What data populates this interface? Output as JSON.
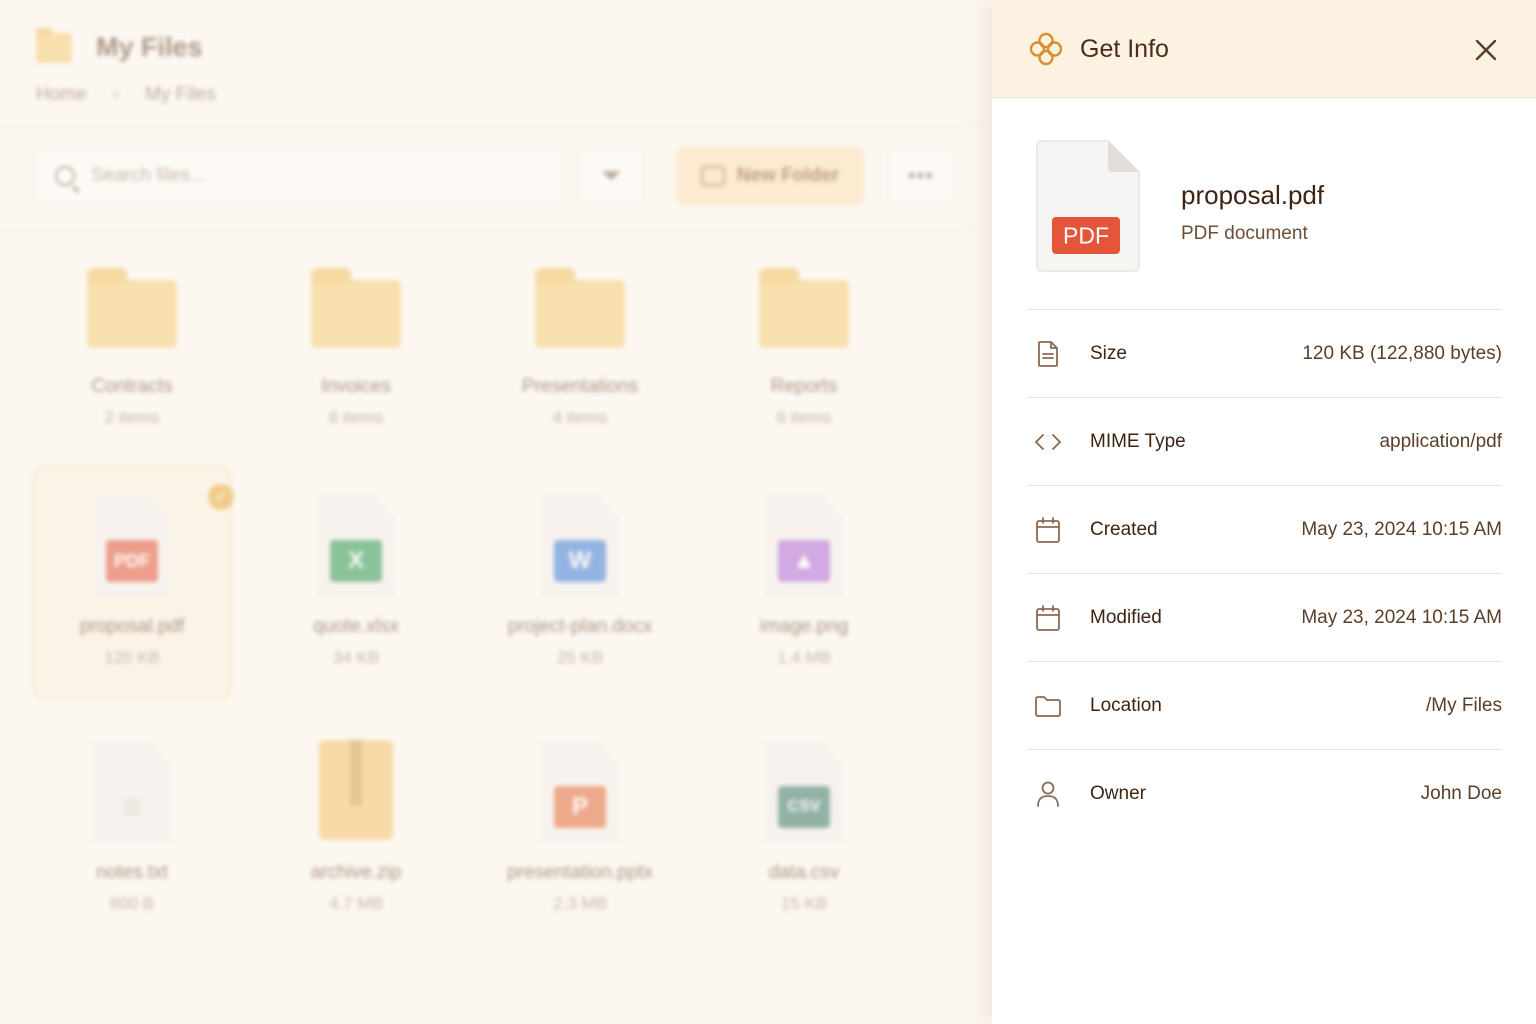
{
  "background": {
    "title": "My Files",
    "breadcrumb": [
      "Home",
      "My Files"
    ],
    "search_placeholder": "Search files...",
    "new_folder_label": "New Folder",
    "more_label": "•••",
    "folders": [
      {
        "name": "Contracts",
        "meta": "2 items"
      },
      {
        "name": "Invoices",
        "meta": "8 items"
      },
      {
        "name": "Presentations",
        "meta": "4 items"
      },
      {
        "name": "Reports",
        "meta": "6 items"
      }
    ],
    "files": [
      {
        "name": "proposal.pdf",
        "meta": "120 KB",
        "badge": "PDF",
        "color": "#e4553a",
        "selected": true
      },
      {
        "name": "quote.xlsx",
        "meta": "34 KB",
        "badge": "X",
        "color": "#2f9a52"
      },
      {
        "name": "project-plan.docx",
        "meta": "25 KB",
        "badge": "W",
        "color": "#3f7fd6"
      },
      {
        "name": "image.png",
        "meta": "1.4 MB",
        "badge": "▲",
        "color": "#b06ad6"
      },
      {
        "name": "notes.txt",
        "meta": "800 B",
        "badge": "≡",
        "color": "#c8c2bc"
      },
      {
        "name": "archive.zip",
        "meta": "4.7 MB",
        "badge": "",
        "color": "#f4c46a"
      },
      {
        "name": "presentation.pptx",
        "meta": "2.3 MB",
        "badge": "P",
        "color": "#e26a3a"
      },
      {
        "name": "data.csv",
        "meta": "15 KB",
        "badge": "CSV",
        "color": "#3d7a6a"
      }
    ]
  },
  "panel": {
    "title": "Get Info",
    "file": {
      "name": "proposal.pdf",
      "type": "PDF document",
      "badge": "PDF"
    },
    "rows": [
      {
        "icon": "document-icon",
        "label": "Size",
        "value": "120 KB (122,880 bytes)"
      },
      {
        "icon": "code-icon",
        "label": "MIME Type",
        "value": "application/pdf"
      },
      {
        "icon": "calendar-icon",
        "label": "Created",
        "value": "May 23, 2024 10:15 AM"
      },
      {
        "icon": "calendar-icon",
        "label": "Modified",
        "value": "May 23, 2024 10:15 AM"
      },
      {
        "icon": "folder-icon",
        "label": "Location",
        "value": "/My Files"
      },
      {
        "icon": "user-icon",
        "label": "Owner",
        "value": "John Doe"
      }
    ]
  },
  "colors": {
    "accent": "#e8a93a",
    "pdf_badge": "#e4553a",
    "header_bg": "#fdf2e2",
    "text": "#3f2412"
  }
}
